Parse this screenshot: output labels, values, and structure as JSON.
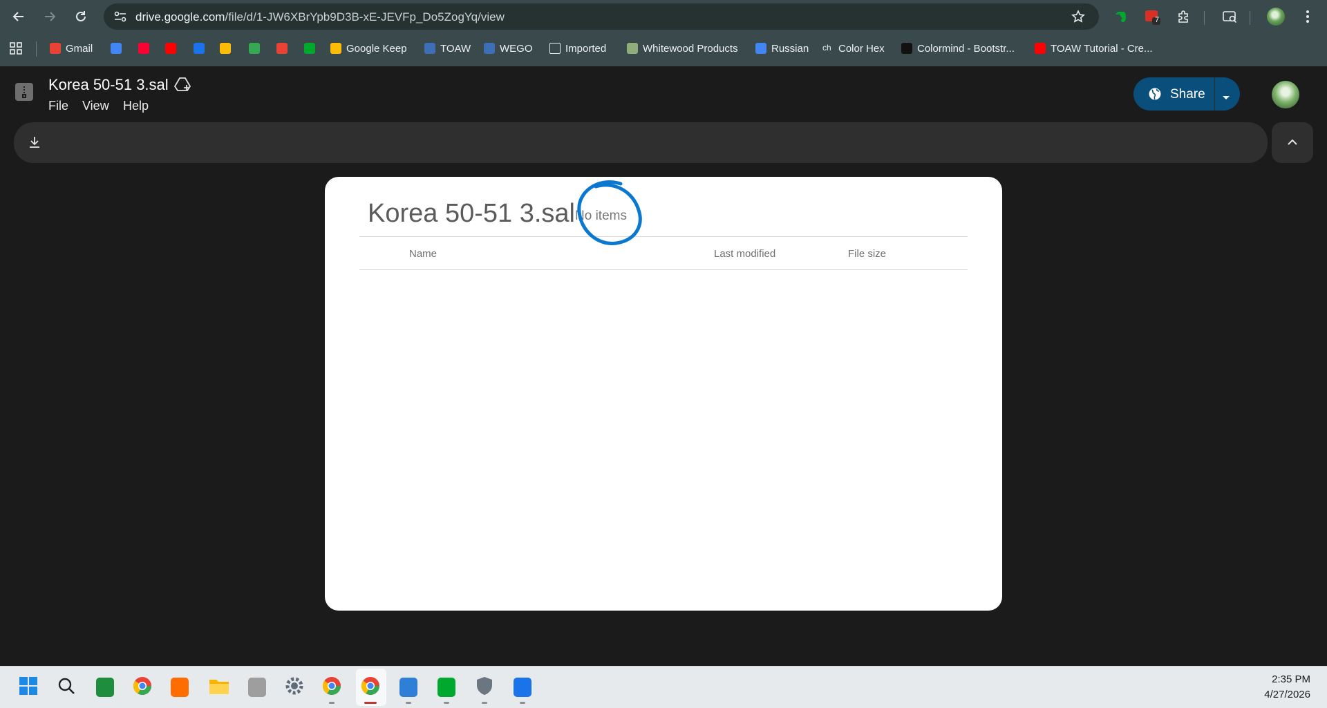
{
  "browser": {
    "url_host": "drive.google.com",
    "url_path": "/file/d/1-JW6XBrYpb9D3B-xE-JEVFp_Do5ZogYq/view",
    "extension_badge": "7",
    "bookmarks": [
      {
        "label": "Gmail",
        "icon": "gmail-icon",
        "color": "#ea4335"
      },
      {
        "label": "",
        "icon": "calendar-icon",
        "color": "#4285f4"
      },
      {
        "label": "",
        "icon": "music-icon",
        "color": "#ff0033"
      },
      {
        "label": "",
        "icon": "youtube-icon",
        "color": "#ff0000"
      },
      {
        "label": "",
        "icon": "person-icon",
        "color": "#1a73e8"
      },
      {
        "label": "",
        "icon": "drive-icon",
        "color": "#fbbc04"
      },
      {
        "label": "",
        "icon": "maps-icon",
        "color": "#34a853"
      },
      {
        "label": "",
        "icon": "photos-icon",
        "color": "#ea4335"
      },
      {
        "label": "",
        "icon": "evernote-icon",
        "color": "#00a82d"
      },
      {
        "label": "Google Keep",
        "icon": "keep-icon",
        "color": "#fbbc04"
      },
      {
        "label": "TOAW",
        "icon": "toaw-icon",
        "color": "#3d6fb6"
      },
      {
        "label": "WEGO",
        "icon": "wego-icon",
        "color": "#3d6fb6"
      },
      {
        "label": "Imported",
        "icon": "folder-icon",
        "color": "#e6ecec"
      },
      {
        "label": "Whitewood Products",
        "icon": "whitewood-icon",
        "color": "#8fae7a"
      },
      {
        "label": "Russian",
        "icon": "translate-icon",
        "color": "#4285f4"
      },
      {
        "label": "Color Hex",
        "icon": "colorhex-icon",
        "color": "#e6ecec"
      },
      {
        "label": "Colormind - Bootstr...",
        "icon": "colormind-icon",
        "color": "#111111"
      },
      {
        "label": "TOAW Tutorial - Cre...",
        "icon": "youtube-icon",
        "color": "#ff0000"
      }
    ]
  },
  "drive": {
    "file_title": "Korea 50-51 3.sal",
    "menu": [
      "File",
      "View",
      "Help"
    ],
    "share_label": "Share"
  },
  "viewer": {
    "title": "Korea 50-51 3.sal",
    "item_count": "No items",
    "columns": {
      "name": "Name",
      "modified": "Last modified",
      "size": "File size"
    },
    "annotation_color": "#0b78d0"
  },
  "taskbar": {
    "apps": [
      "start-icon",
      "search-icon",
      "sheets-icon",
      "chrome-icon",
      "firefox-icon",
      "file-explorer-icon",
      "app-icon",
      "settings-icon",
      "chrome-profile-icon",
      "chrome-icon",
      "notepad-icon",
      "evernote-icon",
      "security-icon",
      "photos-icon"
    ],
    "time": "2:35 PM",
    "date": "4/27/2026"
  },
  "colors": {
    "accent": "#0a4f7c",
    "page_bg": "#1b1b1b",
    "chrome_bg": "#3a4a4c"
  }
}
